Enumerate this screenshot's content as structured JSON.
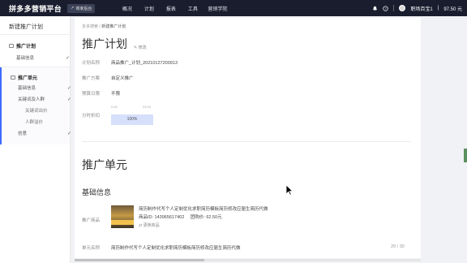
{
  "topbar": {
    "brand": "拼多多营销平台",
    "back_label": "商家后台",
    "nav": [
      "概况",
      "计划",
      "报表",
      "工具",
      "营销学院"
    ],
    "account": "职场百宝1",
    "balance": "97.50 元",
    "icons": [
      "bell-icon",
      "help-icon",
      "avatar"
    ]
  },
  "sidebar": {
    "title": "新建推广计划",
    "plan_group": {
      "label": "推广计划",
      "items": [
        {
          "label": "基础信息",
          "checked": true
        }
      ]
    },
    "unit_group": {
      "label": "推广单元",
      "items": [
        {
          "label": "基础信息",
          "checked": true
        },
        {
          "label": "关键词及人群",
          "checked": true
        }
      ],
      "subitems": [
        {
          "label": "关键词出价",
          "checked": false
        },
        {
          "label": "人群溢价",
          "checked": false
        }
      ],
      "creative": {
        "label": "创意",
        "checked": true
      }
    }
  },
  "main": {
    "breadcrumb": {
      "root": "多多搜索",
      "sep": " / ",
      "current": "新建推广计划"
    },
    "plan_title": "推广计划",
    "edit_label": "修改",
    "rows": [
      {
        "label": "计划名称",
        "value": "商品推广_计划_20210127200913"
      },
      {
        "label": "推广方案",
        "value": "自定义推广"
      },
      {
        "label": "预算日限",
        "value": "不限"
      }
    ],
    "time_label": "分时折扣",
    "time_ticks": [
      "0:00",
      "24:00"
    ],
    "time_value": "100%",
    "unit_title": "推广单元",
    "basic_title": "基础信息",
    "product_label": "推广商品",
    "product": {
      "title": "简历制作代写个人定制优化求职简历模板简历修改应届生简历代做",
      "id_text": "商品ID: 143965617402",
      "price_text": "团购价: 62.50元",
      "change_label": "更换商品"
    },
    "unit_name_label": "单元名称",
    "unit_name_value": "简历制作代写个人定制优化求职简历模板简历修改应届生简历代做",
    "unit_name_count": "29 / 30"
  },
  "colors": {
    "topbar": "#1a1d2e",
    "accent": "#3d6bff",
    "timebar": "#d6e0fb"
  }
}
